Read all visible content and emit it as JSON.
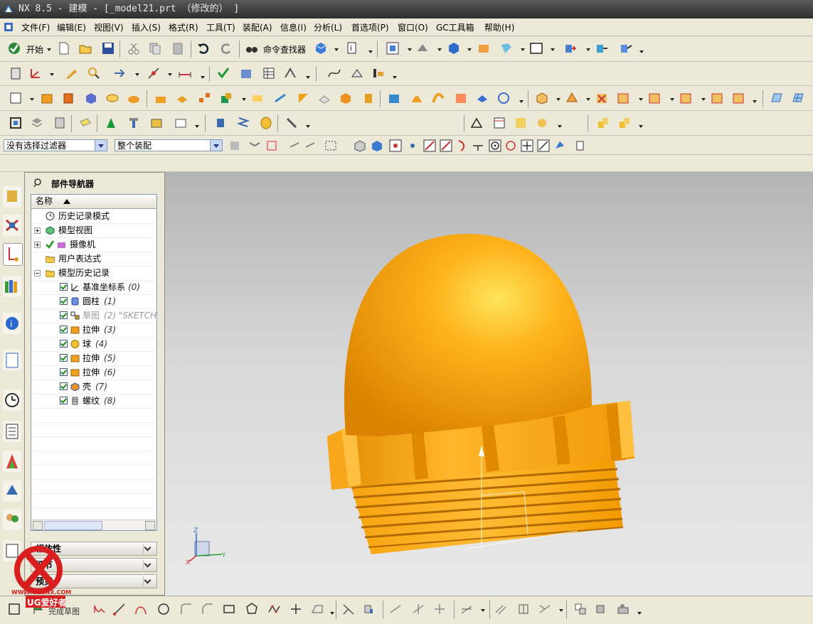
{
  "window": {
    "title": "NX 8.5 - 建模 - [_model21.prt （修改的） ]"
  },
  "menu": [
    "文件(F)",
    "编辑(E)",
    "视图(V)",
    "插入(S)",
    "格式(R)",
    "工具(T)",
    "装配(A)",
    "信息(I)",
    "分析(L)",
    "首选项(P)",
    "窗口(O)",
    "GC工具箱",
    "帮助(H)"
  ],
  "toolbar": {
    "start_label": "开始",
    "command_finder_label": "命令查找器"
  },
  "selection_bar": {
    "filter_value": "没有选择过滤器",
    "scope_value": "整个装配"
  },
  "navigator": {
    "title": "部件导航器",
    "column_header": "名称",
    "items": [
      {
        "label": "历史记录模式",
        "num": ""
      },
      {
        "label": "模型视图",
        "num": ""
      },
      {
        "label": "摄像机",
        "num": ""
      },
      {
        "label": "用户表达式",
        "num": ""
      },
      {
        "label": "模型历史记录",
        "num": ""
      },
      {
        "label": "基准坐标系",
        "num": "(0)"
      },
      {
        "label": "圆柱",
        "num": "(1)"
      },
      {
        "label": "草图",
        "num": "(2) \"SKETCH_"
      },
      {
        "label": "拉伸",
        "num": "(3)"
      },
      {
        "label": "球",
        "num": "(4)"
      },
      {
        "label": "拉伸",
        "num": "(5)"
      },
      {
        "label": "拉伸",
        "num": "(6)"
      },
      {
        "label": "壳",
        "num": "(7)"
      },
      {
        "label": "螺纹",
        "num": "(8)"
      }
    ],
    "sections": [
      "相依性",
      "细节",
      "预览"
    ]
  },
  "status": {
    "text": "完成草图"
  },
  "watermark": {
    "site": "WWW.UGSNX.COM",
    "brand": "UG爱好者"
  },
  "triad": {
    "z": "Z",
    "y": "Y",
    "x": "X"
  },
  "colors": {
    "model": "#f5a10f",
    "model_dark": "#c97d05",
    "model_light": "#ffd24a"
  }
}
